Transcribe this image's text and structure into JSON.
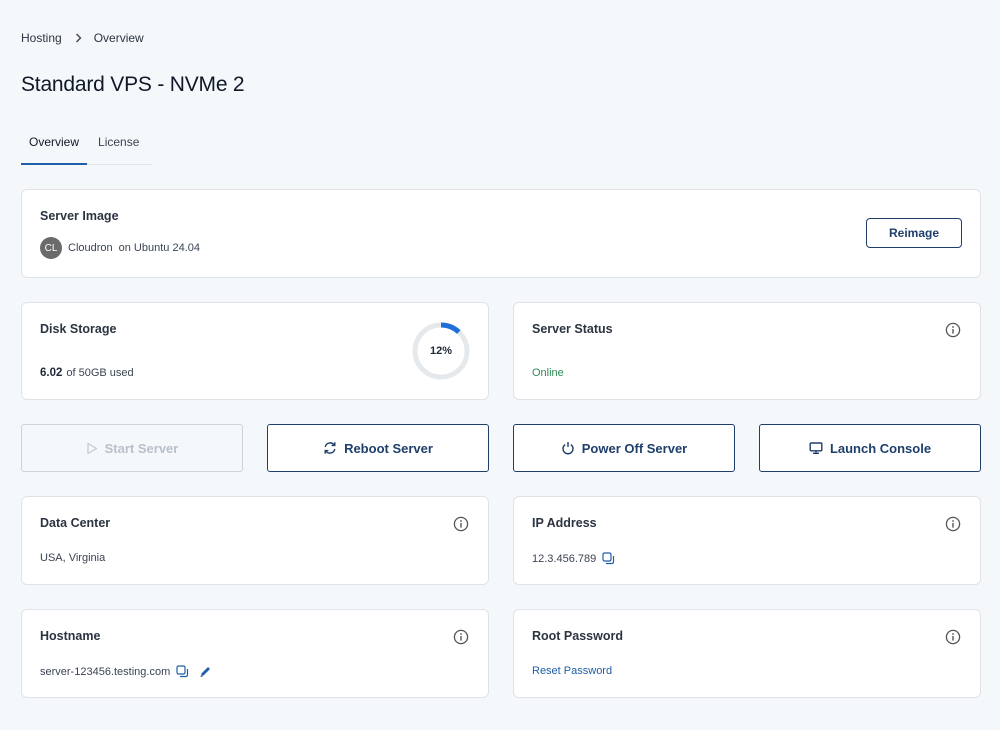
{
  "breadcrumb": {
    "parent": "Hosting",
    "current": "Overview"
  },
  "page": {
    "title": "Standard VPS - NVMe 2"
  },
  "tabs": [
    {
      "label": "Overview",
      "active": true
    },
    {
      "label": "License",
      "active": false
    }
  ],
  "server_image": {
    "title": "Server Image",
    "avatar_initials": "CL",
    "app_name": "Cloudron",
    "os_text": "on Ubuntu 24.04",
    "reimage_label": "Reimage"
  },
  "disk": {
    "title": "Disk Storage",
    "used": "6.02",
    "total_text": "of 50GB used",
    "percent_label": "12%",
    "percent_value": 0.12,
    "ring_color": "#1e6fd9"
  },
  "status": {
    "title": "Server Status",
    "value": "Online",
    "color": "#2e8b57"
  },
  "actions": {
    "start": "Start Server",
    "reboot": "Reboot Server",
    "power_off": "Power Off Server",
    "console": "Launch Console"
  },
  "data_center": {
    "title": "Data Center",
    "value": "USA, Virginia"
  },
  "ip": {
    "title": "IP Address",
    "value": "12.3.456.789"
  },
  "hostname": {
    "title": "Hostname",
    "value": "server-123456.testing.com"
  },
  "root_password": {
    "title": "Root Password",
    "link": "Reset Password"
  },
  "colors": {
    "accent": "#1f3f6b",
    "link": "#1f5ea8",
    "background": "#f5f8fb"
  }
}
